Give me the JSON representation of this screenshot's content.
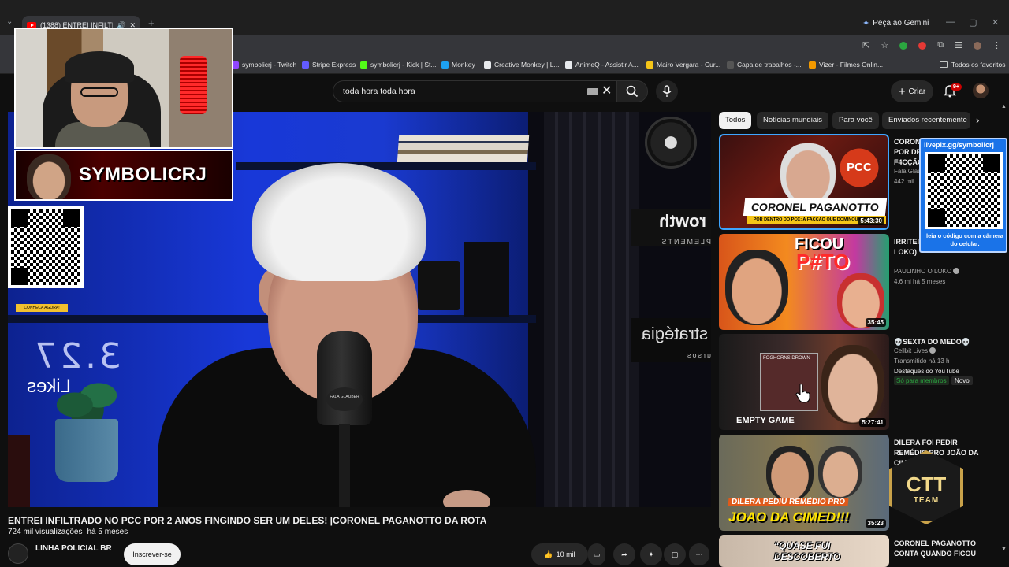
{
  "browser": {
    "tab_title": "(1388) ENTREI INFILTRADO NO PCC",
    "new_tab_symbol": "+",
    "gemini_label": "Peça ao Gemini",
    "bookmarks": [
      {
        "label": "symbolicrj - Twitch",
        "color": "#9146ff"
      },
      {
        "label": "Stripe Express",
        "color": "#635bff"
      },
      {
        "label": "symbolicrj - Kick | St...",
        "color": "#53fc18"
      },
      {
        "label": "Monkey",
        "color": "#1da1f2"
      },
      {
        "label": "Creative Monkey | L...",
        "color": "#e8eaed"
      },
      {
        "label": "AnimeQ - Assistir A...",
        "color": "#e8eaed"
      },
      {
        "label": "Mairo Vergara - Cur...",
        "color": "#f5c518"
      },
      {
        "label": "Capa de trabalhos -...",
        "color": "#555555"
      },
      {
        "label": "Vizer - Filmes Onlin...",
        "color": "#f29900"
      }
    ],
    "all_bookmarks": "Todos os favoritos"
  },
  "header": {
    "search_value": "toda hora toda hora",
    "create_label": "Criar",
    "notifications_badge": "9+"
  },
  "video": {
    "title": "ENTREI INFILTRADO NO PCC POR 2 ANOS FINGINDO SER UM DELES! |CORONEL PAGANOTTO DA ROTA",
    "views": "724 mil visualizações",
    "age": "há 5 meses",
    "channel": "LINHA POLICIAL BR",
    "subscribe_label": "Inscrever-se",
    "likes": "10 mil",
    "scene_likes_number": "3.27",
    "scene_likes_text": "Likes",
    "scene_growth": "rowth",
    "scene_growth_sub": "PLEMENTS",
    "scene_estrat": "stratégia",
    "scene_estrat_sub": "ursos",
    "mic_label": "FALA GLAUBER"
  },
  "overlay": {
    "streamer_name": "SYMBOLICRJ",
    "qr_left_tag": "CONHEÇA AGORA!",
    "qr_right_top": "livepix.gg/symbolicrj",
    "qr_right_bottom": "leia o código com a câmera do celular.",
    "ctt_text": "CTT",
    "ctt_sub": "TEAM"
  },
  "chips": [
    "Todos",
    "Notícias mundiais",
    "Para você",
    "Enviados recentemente"
  ],
  "recommendations": [
    {
      "title": "CORONEL PAGANOTTO: POR DENTRO DO PCC A F4CÇÃO",
      "channel": "Fala Glauber",
      "meta": "442 mil",
      "duration": "5:43:30",
      "thumb_title": "CORONEL PAGANOTTO",
      "thumb_sub": "POR DENTRO DO PCC: A FACÇÃO QUE DOMINOU O BRASIL",
      "thumb_tag": "PCC"
    },
    {
      "title": "IRRITEI ao VIVO (Paulinho o LOKO)",
      "channel": "PAULINHO O LOKO",
      "meta": "4,6 mi   há 5 meses",
      "duration": "35:45",
      "thumb_line1": "FICOU",
      "thumb_line2": "P#TO"
    },
    {
      "title": "💀SEXTA DO MEDO💀",
      "channel": "Cellbit Lives",
      "meta": "Transmitido há 13 h",
      "extra": "Destaques do YouTube",
      "members": "Só para membros",
      "new": "Novo",
      "duration": "5:27:41",
      "thumb_text": "EMPTY GAME",
      "thumb_sign": "FOGHORNS DROWN"
    },
    {
      "title": "DILERA FOI PEDIR REMÉDIO PRO JOÃO DA CIMED",
      "duration": "35:23",
      "thumb_line1": "DILERA PEDIU REMÉDIO PRO",
      "thumb_line2": "JOAO DA CIMED!!!"
    },
    {
      "title": "CORONEL PAGANOTTO CONTA QUANDO FICOU",
      "thumb_text": "“QUASE FUI DESCOBERTO"
    }
  ]
}
